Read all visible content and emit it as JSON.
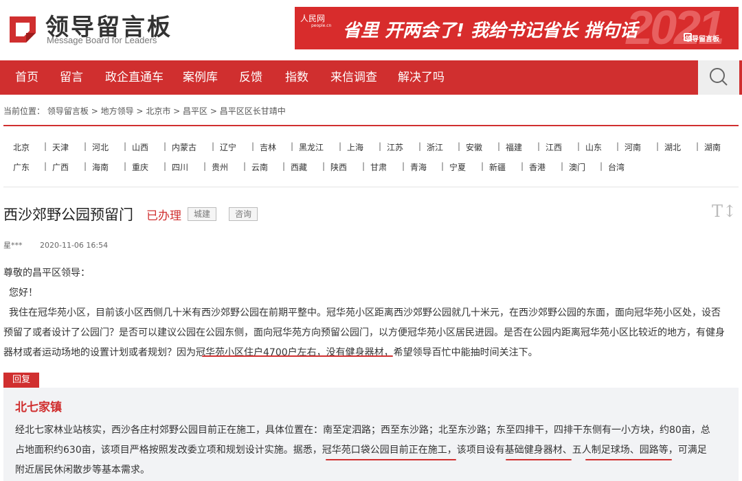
{
  "site": {
    "title": "领导留言板",
    "subtitle": "Message Board for Leaders"
  },
  "banner": {
    "people": "人民网",
    "people_sub": "people.cn",
    "text": "省里 开两会了! 我给书记省长 捎句话",
    "year": "2021",
    "brand": "领导留言板"
  },
  "nav": {
    "items": [
      "首页",
      "留言",
      "政企直通车",
      "案例库",
      "反馈",
      "指数",
      "来信调查",
      "解决了吗"
    ],
    "search_icon": "search-icon"
  },
  "breadcrumb": {
    "prefix": "当前位置：",
    "items": [
      "领导留言板",
      "地方领导",
      "北京市",
      "昌平区",
      "昌平区区长甘靖中"
    ],
    "sep": ">"
  },
  "regions": {
    "row1": [
      "北京",
      "天津",
      "河北",
      "山西",
      "内蒙古",
      "辽宁",
      "吉林",
      "黑龙江",
      "上海",
      "江苏",
      "浙江",
      "安徽",
      "福建",
      "江西",
      "山东",
      "河南",
      "湖北",
      "湖南"
    ],
    "row2": [
      "广东",
      "广西",
      "海南",
      "重庆",
      "四川",
      "贵州",
      "云南",
      "西藏",
      "陕西",
      "甘肃",
      "青海",
      "宁夏",
      "新疆",
      "香港",
      "澳门",
      "台湾"
    ]
  },
  "post": {
    "title": "西沙郊野公园预留门",
    "status": "已办理",
    "tags": [
      "城建",
      "咨询"
    ],
    "font_toggle": "T↕",
    "author": "星***",
    "date": "2020-11-06 16:54",
    "salutation": "尊敬的昌平区领导：",
    "greeting": "您好！",
    "line1": "我住在冠华苑小区，目前该小区西侧几十米有西沙郊野公园在前期平整中。冠华苑小区距离西沙郊野公园就几十米元，在西沙郊野公园的东面，面向冠华苑小区处，设否",
    "line2": "预留了或者设计了公园门？是否可以建议公园在公园东侧，面向冠华苑方向预留公园门，以方便冠华苑小区居民进园。是否在公园内距离冠华苑小区比较近的地方，有健身",
    "line3": "器材或者运动场地的设置计划或者规划？因为冠华苑小区住户4700户左右，没有健身器材，希望领导百忙中能抽时间关注下。"
  },
  "reply": {
    "label": "回复",
    "org": "北七家镇",
    "line1": "经北七家林业站核实，西沙各庄村郊野公园目前正在施工，具体位置在：南至定泗路；西至东沙路；北至东沙路；东至四排干，四排干东侧有一小方块，约80亩，总",
    "line2": "占地面积约630亩，该项目严格按照发改委立项和规划设计实施。据悉，冠华苑口袋公园目前正在施工，该项目设有基础健身器材、五人制足球场、园路等，可满足",
    "line3": "附近居民休闲散步等基本需求。"
  },
  "colors": {
    "brand_red": "#d02f2f",
    "reply_bg": "#f2f3f5"
  }
}
